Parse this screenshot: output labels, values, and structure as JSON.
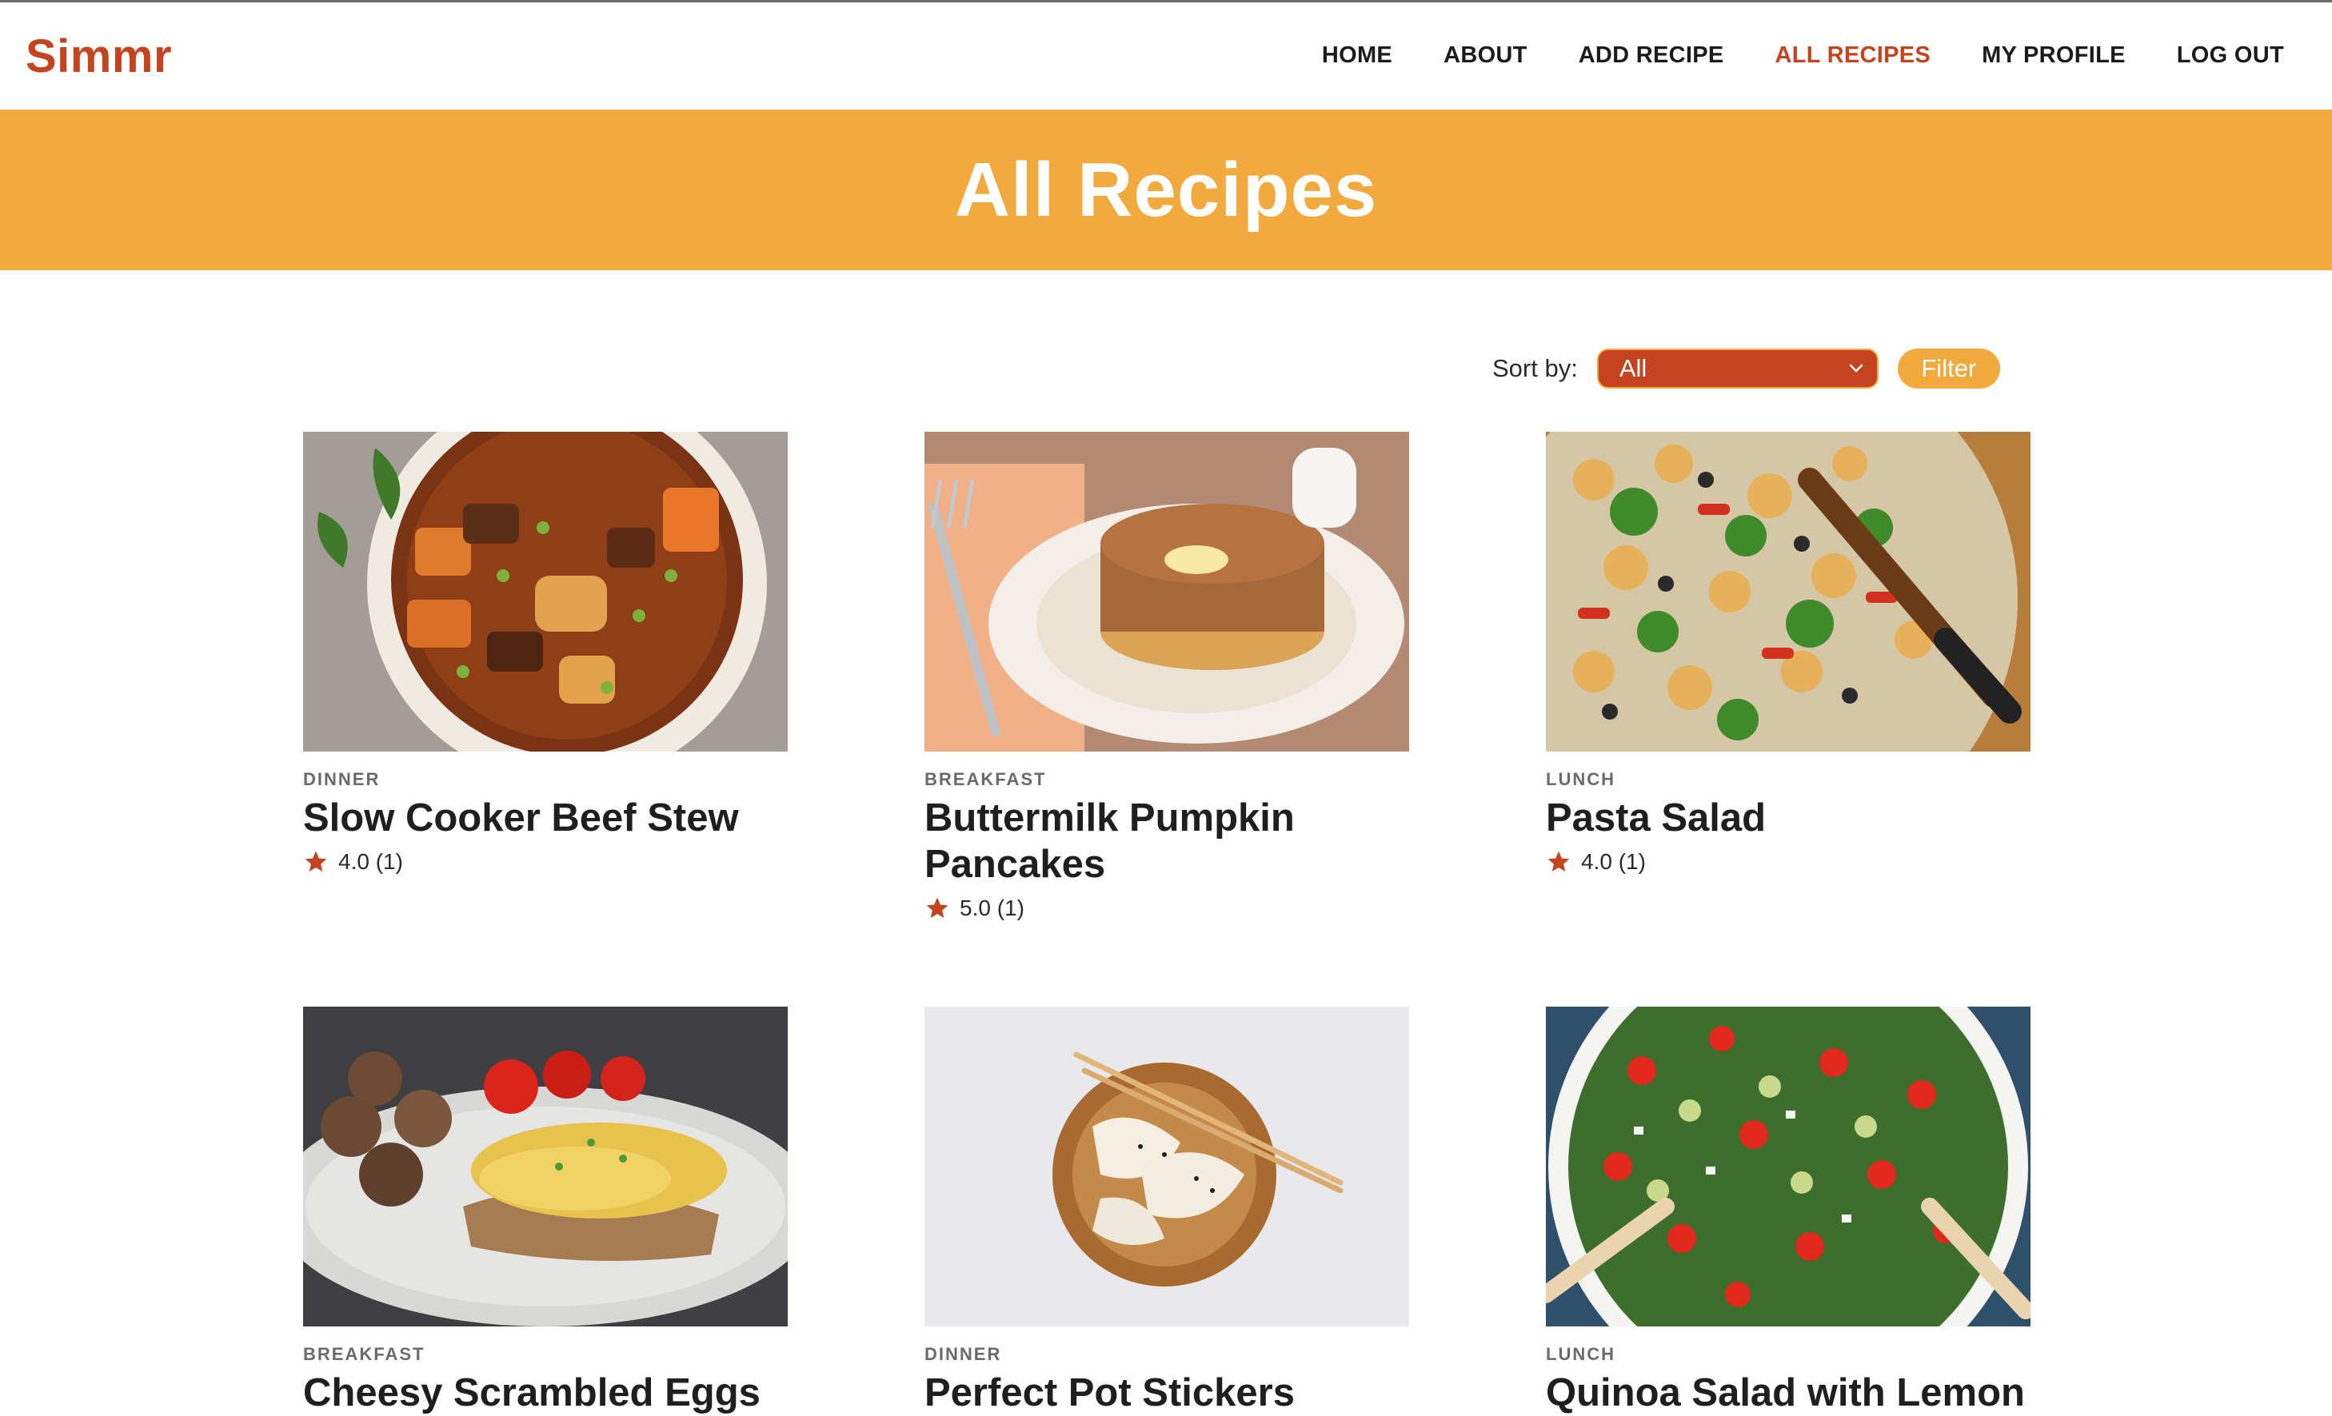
{
  "brand": {
    "name": "Simmr",
    "accent": "#c4441f",
    "banner_color": "#f2a93e"
  },
  "nav": {
    "home": "HOME",
    "about": "ABOUT",
    "add_recipe": "ADD RECIPE",
    "all_recipes": "ALL RECIPES",
    "my_profile": "MY PROFILE",
    "log_out": "LOG OUT",
    "active": "ALL RECIPES"
  },
  "banner": {
    "title": "All Recipes"
  },
  "sort": {
    "label": "Sort by:",
    "selected": "All",
    "filter_label": "Filter"
  },
  "recipes": [
    {
      "category": "DINNER",
      "title": "Slow Cooker Beef Stew",
      "rating": "4.0 (1)",
      "image": "beef-stew-photo"
    },
    {
      "category": "BREAKFAST",
      "title": "Buttermilk Pumpkin Pancakes",
      "rating": "5.0 (1)",
      "image": "pumpkin-pancakes-photo"
    },
    {
      "category": "LUNCH",
      "title": "Pasta Salad",
      "rating": "4.0 (1)",
      "image": "pasta-salad-photo"
    },
    {
      "category": "BREAKFAST",
      "title": "Cheesy Scrambled Eggs",
      "rating": "",
      "image": "scrambled-eggs-photo"
    },
    {
      "category": "DINNER",
      "title": "Perfect Pot Stickers",
      "rating": "",
      "image": "pot-stickers-photo"
    },
    {
      "category": "LUNCH",
      "title": "Quinoa Salad with Lemon",
      "rating": "",
      "image": "quinoa-salad-photo"
    }
  ],
  "icons": {
    "star": "star-icon",
    "chevron": "chevron-down-icon"
  }
}
